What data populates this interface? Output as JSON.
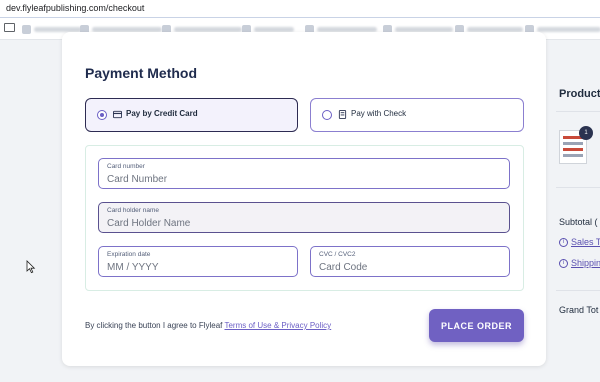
{
  "browser": {
    "url": "dev.flyleafpublishing.com/checkout"
  },
  "payment": {
    "title": "Payment Method",
    "options": [
      {
        "label": "Pay by Credit Card",
        "selected": true
      },
      {
        "label": "Pay with Check",
        "selected": false
      }
    ],
    "fields": {
      "card_number": {
        "label": "Card number",
        "placeholder": "Card Number"
      },
      "card_holder": {
        "label": "Card holder name",
        "placeholder": "Card Holder Name"
      },
      "expiration": {
        "label": "Expiration date",
        "placeholder": "MM / YYYY"
      },
      "cvc": {
        "label": "CVC / CVC2",
        "placeholder": "Card Code"
      }
    },
    "terms_prefix": "By clicking the button I agree to Flyleaf",
    "terms_link": "Terms of Use & Privacy Policy",
    "place_order": "PLACE ORDER"
  },
  "summary": {
    "title": "Product",
    "item_badge": "1",
    "subtotal": "Subtotal (",
    "sales_tax": "Sales T",
    "shipping": "Shippin",
    "grand_total": "Grand Tot"
  },
  "colors": {
    "accent": "#7061c2",
    "selected_border": "#2d2b52",
    "background": "#f1f3f6"
  }
}
